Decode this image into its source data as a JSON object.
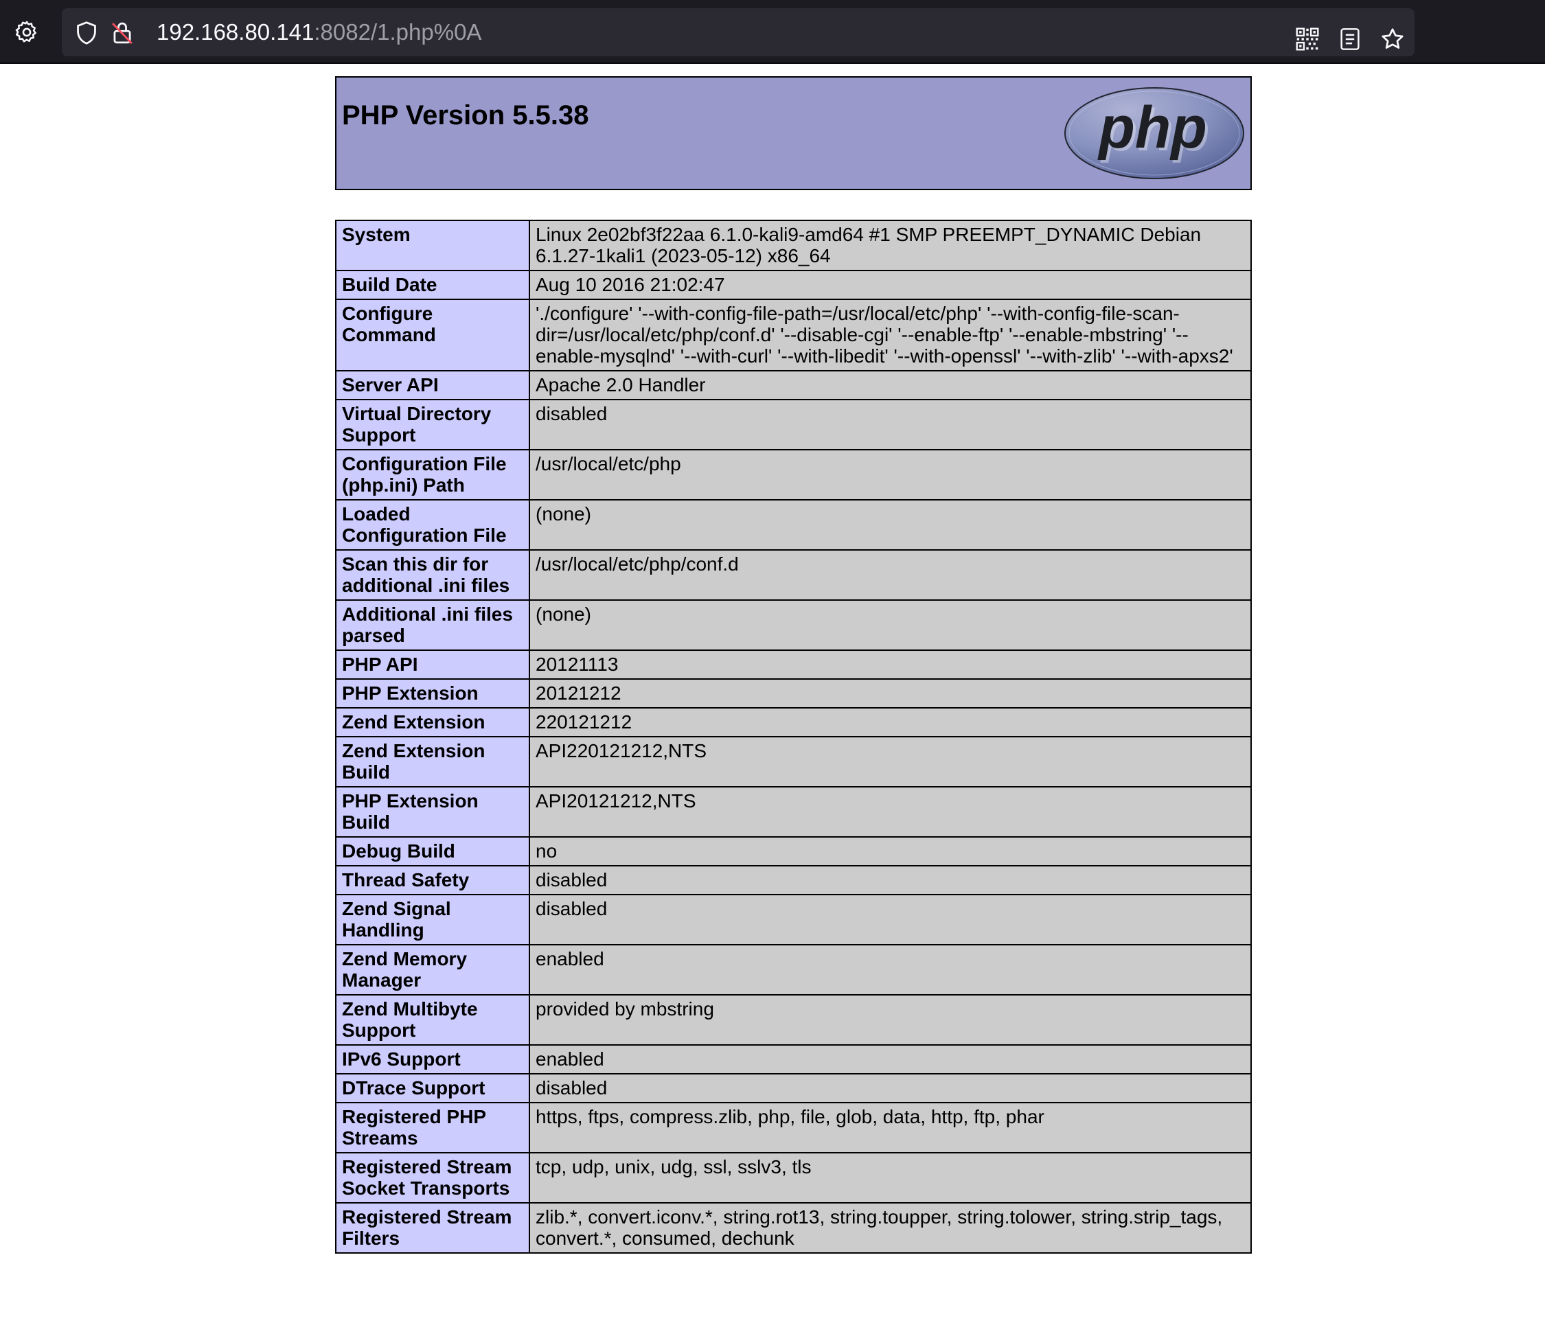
{
  "browser": {
    "url_host": "192.168.80.141",
    "url_path": ":8082/1.php%0A",
    "icons": {
      "settings": "gear-icon",
      "tracking": "shield-icon",
      "insecure": "insecure-lock-icon",
      "qr": "qr-code-icon",
      "reader": "reader-view-icon",
      "bookmark": "star-icon"
    }
  },
  "header": {
    "title": "PHP Version 5.5.38",
    "logo_text": "php"
  },
  "info_rows": [
    {
      "label": "System",
      "value": "Linux 2e02bf3f22aa 6.1.0-kali9-amd64 #1 SMP PREEMPT_DYNAMIC Debian 6.1.27-1kali1 (2023-05-12) x86_64"
    },
    {
      "label": "Build Date",
      "value": "Aug 10 2016 21:02:47"
    },
    {
      "label": "Configure Command",
      "value": "'./configure' '--with-config-file-path=/usr/local/etc/php' '--with-config-file-scan-dir=/usr/local/etc/php/conf.d' '--disable-cgi' '--enable-ftp' '--enable-mbstring' '--enable-mysqlnd' '--with-curl' '--with-libedit' '--with-openssl' '--with-zlib' '--with-apxs2'"
    },
    {
      "label": "Server API",
      "value": "Apache 2.0 Handler"
    },
    {
      "label": "Virtual Directory Support",
      "value": "disabled"
    },
    {
      "label": "Configuration File (php.ini) Path",
      "value": "/usr/local/etc/php"
    },
    {
      "label": "Loaded Configuration File",
      "value": "(none)"
    },
    {
      "label": "Scan this dir for additional .ini files",
      "value": "/usr/local/etc/php/conf.d"
    },
    {
      "label": "Additional .ini files parsed",
      "value": "(none)"
    },
    {
      "label": "PHP API",
      "value": "20121113"
    },
    {
      "label": "PHP Extension",
      "value": "20121212"
    },
    {
      "label": "Zend Extension",
      "value": "220121212"
    },
    {
      "label": "Zend Extension Build",
      "value": "API220121212,NTS"
    },
    {
      "label": "PHP Extension Build",
      "value": "API20121212,NTS"
    },
    {
      "label": "Debug Build",
      "value": "no"
    },
    {
      "label": "Thread Safety",
      "value": "disabled"
    },
    {
      "label": "Zend Signal Handling",
      "value": "disabled"
    },
    {
      "label": "Zend Memory Manager",
      "value": "enabled"
    },
    {
      "label": "Zend Multibyte Support",
      "value": "provided by mbstring"
    },
    {
      "label": "IPv6 Support",
      "value": "enabled"
    },
    {
      "label": "DTrace Support",
      "value": "disabled"
    },
    {
      "label": "Registered PHP Streams",
      "value": "https, ftps, compress.zlib, php, file, glob, data, http, ftp, phar"
    },
    {
      "label": "Registered Stream Socket Transports",
      "value": "tcp, udp, unix, udg, ssl, sslv3, tls"
    },
    {
      "label": "Registered Stream Filters",
      "value": "zlib.*, convert.iconv.*, string.rot13, string.toupper, string.tolower, string.strip_tags, convert.*, consumed, dechunk"
    }
  ],
  "colors": {
    "toolbar": "#1c1b22",
    "urlbar": "#2b2a33",
    "header_bg": "#9999cc",
    "label_bg": "#ccccff",
    "value_bg": "#cccccc"
  }
}
